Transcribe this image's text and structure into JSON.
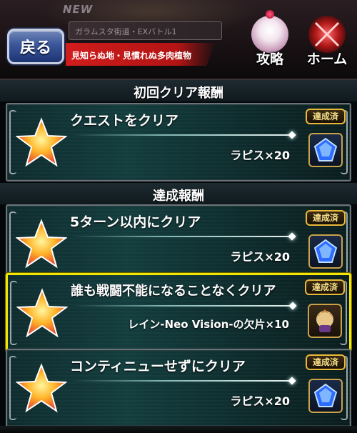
{
  "header": {
    "new_label": "NEW",
    "quest_name": "ガラムスタ街道・EXバトル1",
    "quest_subtitle": "見知らぬ地・見慣れぬ多肉植物",
    "back_label": "戻る",
    "strategy_label": "攻略",
    "home_label": "ホーム"
  },
  "sections": {
    "first_clear_title": "初回クリア報酬",
    "achievement_title": "達成報酬"
  },
  "badge_label": "達成済",
  "rewards": [
    {
      "title": "クエストをクリア",
      "reward": "ラピス×20",
      "item_icon": "lapis-icon"
    },
    {
      "title": "5ターン以内にクリア",
      "reward": "ラピス×20",
      "item_icon": "lapis-icon"
    },
    {
      "title": "誰も戦闘不能になることなくクリア",
      "reward": "レイン-Neo Vision-の欠片×10",
      "item_icon": "rain-shard-icon"
    },
    {
      "title": "コンティニューせずにクリア",
      "reward": "ラピス×20",
      "item_icon": "lapis-icon"
    }
  ],
  "colors": {
    "highlight": "#f3e600",
    "back_button": "#3a5698",
    "badge_border": "#e8b93a",
    "card_bg": "#133d3e"
  }
}
